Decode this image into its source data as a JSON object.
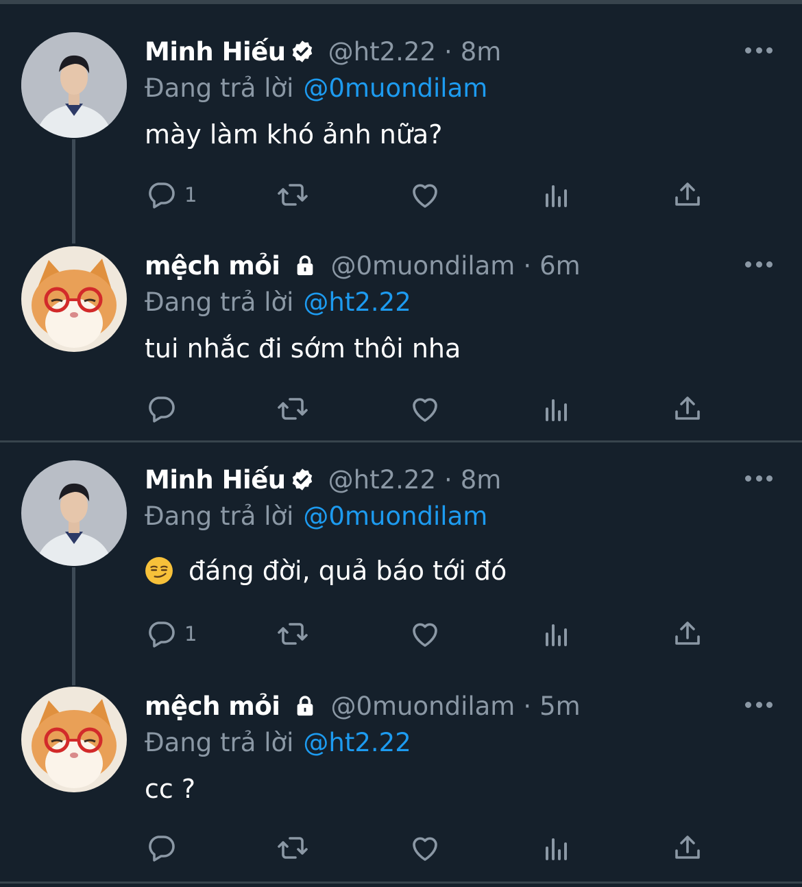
{
  "colors": {
    "background": "#15202b",
    "text": "#ffffff",
    "secondary": "#8b98a5",
    "link": "#1d9bf0",
    "divider": "#38444d"
  },
  "tweets": [
    {
      "author": "Minh Hiếu",
      "badge": "verified-badge-icon",
      "handle": "@ht2.22",
      "separator": "·",
      "time": "8m",
      "replying_label": "Đang trả lời",
      "replying_to": "@0muondilam",
      "text": "mày làm khó ảnh nữa?",
      "reply_count": "1",
      "avatar": "man-portrait"
    },
    {
      "author": "mệch mỏi",
      "badge": "lock-icon",
      "handle": "@0muondilam",
      "separator": "·",
      "time": "6m",
      "replying_label": "Đang trả lời",
      "replying_to": "@ht2.22",
      "text": "tui nhắc đi sớm thôi nha",
      "reply_count": "",
      "avatar": "cat-with-glasses"
    },
    {
      "author": "Minh Hiếu",
      "badge": "verified-badge-icon",
      "handle": "@ht2.22",
      "separator": "·",
      "time": "8m",
      "replying_label": "Đang trả lời",
      "replying_to": "@0muondilam",
      "emoji": "smirking-face-emoji",
      "text": "đáng đời, quả báo tới đó",
      "reply_count": "1",
      "avatar": "man-portrait"
    },
    {
      "author": "mệch mỏi",
      "badge": "lock-icon",
      "handle": "@0muondilam",
      "separator": "·",
      "time": "5m",
      "replying_label": "Đang trả lời",
      "replying_to": "@ht2.22",
      "text": "cc ?",
      "reply_count": "",
      "avatar": "cat-with-glasses"
    }
  ],
  "action_icons": [
    "reply-icon",
    "retweet-icon",
    "like-icon",
    "analytics-icon",
    "share-icon"
  ]
}
